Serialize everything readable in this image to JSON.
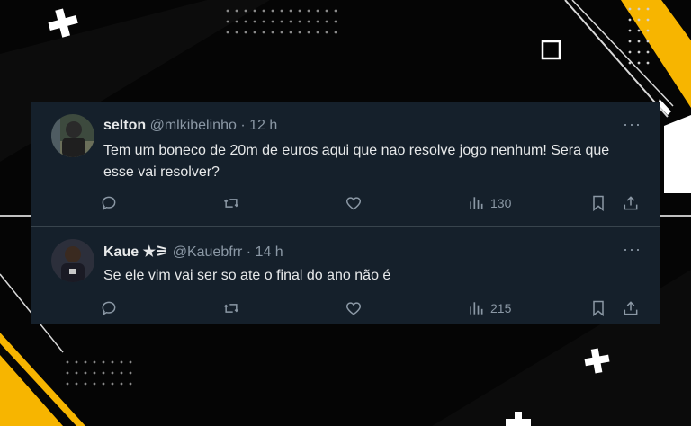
{
  "tweets": [
    {
      "name": "selton",
      "handle": "@mlkibelinho",
      "time": "· 12 h",
      "text": "Tem um boneco de 20m de euros aqui que nao resolve jogo nenhum! Sera que esse vai resolver?",
      "views": "130",
      "more": "···"
    },
    {
      "name": "Kaue ★⚞",
      "handle": "@Kauebfrr",
      "time": "· 14 h",
      "text": "Se ele vim vai ser so ate o final do ano não é",
      "views": "215",
      "more": "···"
    }
  ],
  "colors": {
    "card_bg": "#15202b",
    "text_primary": "#e7e9ea",
    "text_secondary": "#8b98a5",
    "accent_yellow": "#f7b500"
  },
  "icons": [
    "reply-icon",
    "retweet-icon",
    "like-icon",
    "views-icon",
    "bookmark-icon",
    "share-icon",
    "more-icon"
  ]
}
